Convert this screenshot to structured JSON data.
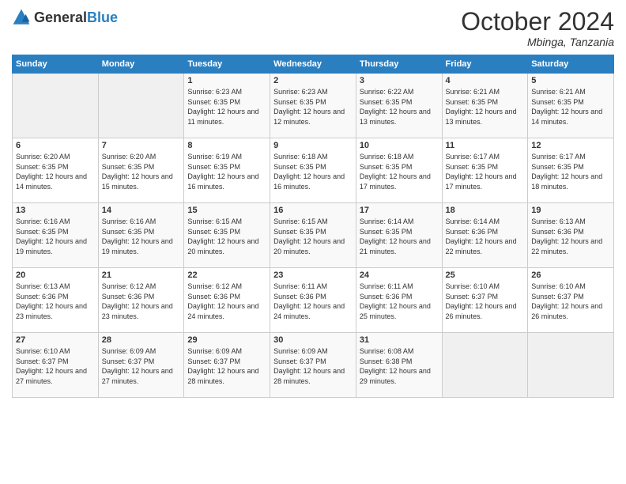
{
  "header": {
    "logo_general": "General",
    "logo_blue": "Blue",
    "month_year": "October 2024",
    "location": "Mbinga, Tanzania"
  },
  "days_of_week": [
    "Sunday",
    "Monday",
    "Tuesday",
    "Wednesday",
    "Thursday",
    "Friday",
    "Saturday"
  ],
  "weeks": [
    [
      {
        "day": "",
        "sunrise": "",
        "sunset": "",
        "daylight": ""
      },
      {
        "day": "",
        "sunrise": "",
        "sunset": "",
        "daylight": ""
      },
      {
        "day": "1",
        "sunrise": "Sunrise: 6:23 AM",
        "sunset": "Sunset: 6:35 PM",
        "daylight": "Daylight: 12 hours and 11 minutes."
      },
      {
        "day": "2",
        "sunrise": "Sunrise: 6:23 AM",
        "sunset": "Sunset: 6:35 PM",
        "daylight": "Daylight: 12 hours and 12 minutes."
      },
      {
        "day": "3",
        "sunrise": "Sunrise: 6:22 AM",
        "sunset": "Sunset: 6:35 PM",
        "daylight": "Daylight: 12 hours and 13 minutes."
      },
      {
        "day": "4",
        "sunrise": "Sunrise: 6:21 AM",
        "sunset": "Sunset: 6:35 PM",
        "daylight": "Daylight: 12 hours and 13 minutes."
      },
      {
        "day": "5",
        "sunrise": "Sunrise: 6:21 AM",
        "sunset": "Sunset: 6:35 PM",
        "daylight": "Daylight: 12 hours and 14 minutes."
      }
    ],
    [
      {
        "day": "6",
        "sunrise": "Sunrise: 6:20 AM",
        "sunset": "Sunset: 6:35 PM",
        "daylight": "Daylight: 12 hours and 14 minutes."
      },
      {
        "day": "7",
        "sunrise": "Sunrise: 6:20 AM",
        "sunset": "Sunset: 6:35 PM",
        "daylight": "Daylight: 12 hours and 15 minutes."
      },
      {
        "day": "8",
        "sunrise": "Sunrise: 6:19 AM",
        "sunset": "Sunset: 6:35 PM",
        "daylight": "Daylight: 12 hours and 16 minutes."
      },
      {
        "day": "9",
        "sunrise": "Sunrise: 6:18 AM",
        "sunset": "Sunset: 6:35 PM",
        "daylight": "Daylight: 12 hours and 16 minutes."
      },
      {
        "day": "10",
        "sunrise": "Sunrise: 6:18 AM",
        "sunset": "Sunset: 6:35 PM",
        "daylight": "Daylight: 12 hours and 17 minutes."
      },
      {
        "day": "11",
        "sunrise": "Sunrise: 6:17 AM",
        "sunset": "Sunset: 6:35 PM",
        "daylight": "Daylight: 12 hours and 17 minutes."
      },
      {
        "day": "12",
        "sunrise": "Sunrise: 6:17 AM",
        "sunset": "Sunset: 6:35 PM",
        "daylight": "Daylight: 12 hours and 18 minutes."
      }
    ],
    [
      {
        "day": "13",
        "sunrise": "Sunrise: 6:16 AM",
        "sunset": "Sunset: 6:35 PM",
        "daylight": "Daylight: 12 hours and 19 minutes."
      },
      {
        "day": "14",
        "sunrise": "Sunrise: 6:16 AM",
        "sunset": "Sunset: 6:35 PM",
        "daylight": "Daylight: 12 hours and 19 minutes."
      },
      {
        "day": "15",
        "sunrise": "Sunrise: 6:15 AM",
        "sunset": "Sunset: 6:35 PM",
        "daylight": "Daylight: 12 hours and 20 minutes."
      },
      {
        "day": "16",
        "sunrise": "Sunrise: 6:15 AM",
        "sunset": "Sunset: 6:35 PM",
        "daylight": "Daylight: 12 hours and 20 minutes."
      },
      {
        "day": "17",
        "sunrise": "Sunrise: 6:14 AM",
        "sunset": "Sunset: 6:35 PM",
        "daylight": "Daylight: 12 hours and 21 minutes."
      },
      {
        "day": "18",
        "sunrise": "Sunrise: 6:14 AM",
        "sunset": "Sunset: 6:36 PM",
        "daylight": "Daylight: 12 hours and 22 minutes."
      },
      {
        "day": "19",
        "sunrise": "Sunrise: 6:13 AM",
        "sunset": "Sunset: 6:36 PM",
        "daylight": "Daylight: 12 hours and 22 minutes."
      }
    ],
    [
      {
        "day": "20",
        "sunrise": "Sunrise: 6:13 AM",
        "sunset": "Sunset: 6:36 PM",
        "daylight": "Daylight: 12 hours and 23 minutes."
      },
      {
        "day": "21",
        "sunrise": "Sunrise: 6:12 AM",
        "sunset": "Sunset: 6:36 PM",
        "daylight": "Daylight: 12 hours and 23 minutes."
      },
      {
        "day": "22",
        "sunrise": "Sunrise: 6:12 AM",
        "sunset": "Sunset: 6:36 PM",
        "daylight": "Daylight: 12 hours and 24 minutes."
      },
      {
        "day": "23",
        "sunrise": "Sunrise: 6:11 AM",
        "sunset": "Sunset: 6:36 PM",
        "daylight": "Daylight: 12 hours and 24 minutes."
      },
      {
        "day": "24",
        "sunrise": "Sunrise: 6:11 AM",
        "sunset": "Sunset: 6:36 PM",
        "daylight": "Daylight: 12 hours and 25 minutes."
      },
      {
        "day": "25",
        "sunrise": "Sunrise: 6:10 AM",
        "sunset": "Sunset: 6:37 PM",
        "daylight": "Daylight: 12 hours and 26 minutes."
      },
      {
        "day": "26",
        "sunrise": "Sunrise: 6:10 AM",
        "sunset": "Sunset: 6:37 PM",
        "daylight": "Daylight: 12 hours and 26 minutes."
      }
    ],
    [
      {
        "day": "27",
        "sunrise": "Sunrise: 6:10 AM",
        "sunset": "Sunset: 6:37 PM",
        "daylight": "Daylight: 12 hours and 27 minutes."
      },
      {
        "day": "28",
        "sunrise": "Sunrise: 6:09 AM",
        "sunset": "Sunset: 6:37 PM",
        "daylight": "Daylight: 12 hours and 27 minutes."
      },
      {
        "day": "29",
        "sunrise": "Sunrise: 6:09 AM",
        "sunset": "Sunset: 6:37 PM",
        "daylight": "Daylight: 12 hours and 28 minutes."
      },
      {
        "day": "30",
        "sunrise": "Sunrise: 6:09 AM",
        "sunset": "Sunset: 6:37 PM",
        "daylight": "Daylight: 12 hours and 28 minutes."
      },
      {
        "day": "31",
        "sunrise": "Sunrise: 6:08 AM",
        "sunset": "Sunset: 6:38 PM",
        "daylight": "Daylight: 12 hours and 29 minutes."
      },
      {
        "day": "",
        "sunrise": "",
        "sunset": "",
        "daylight": ""
      },
      {
        "day": "",
        "sunrise": "",
        "sunset": "",
        "daylight": ""
      }
    ]
  ]
}
